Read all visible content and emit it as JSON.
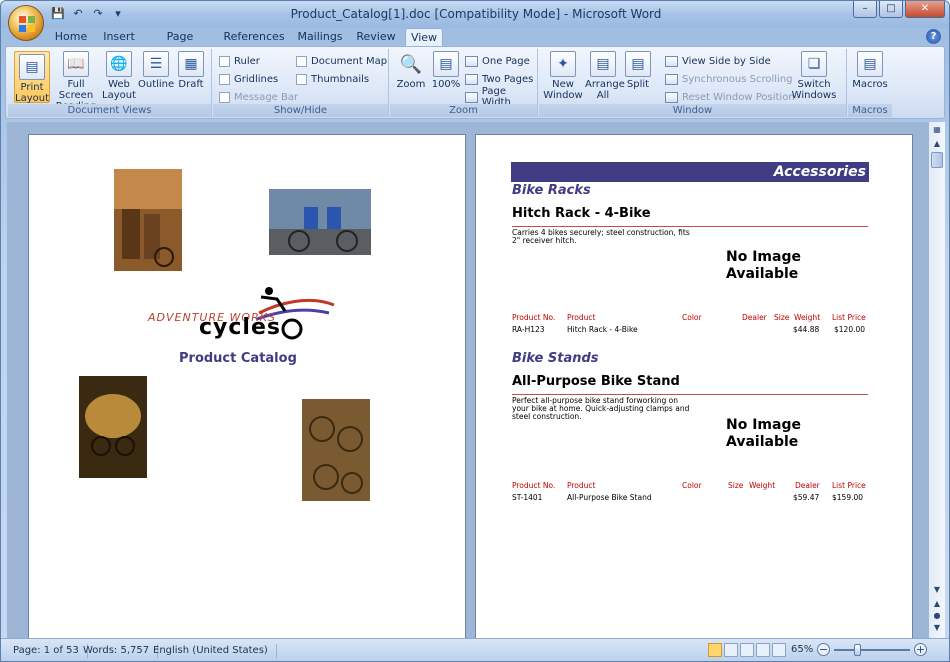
{
  "window": {
    "title": "Product_Catalog[1].doc [Compatibility Mode] - Microsoft Word",
    "help_glyph": "?"
  },
  "tabs": [
    {
      "label": "Home"
    },
    {
      "label": "Insert"
    },
    {
      "label": "Page Layout"
    },
    {
      "label": "References"
    },
    {
      "label": "Mailings"
    },
    {
      "label": "Review"
    },
    {
      "label": "View"
    }
  ],
  "ribbon": {
    "document_views": {
      "label": "Document Views",
      "print_layout": "Print Layout",
      "full_screen_reading": "Full Screen Reading",
      "web_layout": "Web Layout",
      "outline": "Outline",
      "draft": "Draft"
    },
    "show_hide": {
      "label": "Show/Hide",
      "ruler": "Ruler",
      "gridlines": "Gridlines",
      "message_bar": "Message Bar",
      "document_map": "Document Map",
      "thumbnails": "Thumbnails"
    },
    "zoom": {
      "label": "Zoom",
      "zoom": "Zoom",
      "hundred": "100%",
      "one_page": "One Page",
      "two_pages": "Two Pages",
      "page_width": "Page Width"
    },
    "window": {
      "label": "Window",
      "new_window": "New Window",
      "arrange_all": "Arrange All",
      "split": "Split",
      "view_side_by_side": "View Side by Side",
      "synchronous_scrolling": "Synchronous Scrolling",
      "reset_window_position": "Reset Window Position",
      "switch_windows": "Switch Windows"
    },
    "macros": {
      "label": "Macros",
      "macros": "Macros"
    }
  },
  "left_page": {
    "logo_text_top": "ADVENTURE WORKS",
    "logo_text_main": "cycles",
    "catalog_title": "Product Catalog"
  },
  "right_page": {
    "header": "Accessories",
    "sections": [
      {
        "category": "Bike Racks",
        "product": "Hitch Rack - 4-Bike",
        "description": "Carries 4 bikes securely; steel construction, fits 2\" receiver hitch.",
        "no_image": "No Image Available",
        "columns": [
          "Product No.",
          "Product",
          "Color",
          "Dealer",
          "Size",
          "Weight",
          "List Price"
        ],
        "row": {
          "product_no": "RA-H123",
          "product": "Hitch Rack - 4-Bike",
          "dealer": "$44.88",
          "list_price": "$120.00"
        }
      },
      {
        "category": "Bike Stands",
        "product": "All-Purpose Bike Stand",
        "description": "Perfect all-purpose bike stand forworking on your bike at home. Quick-adjusting clamps and steel construction.",
        "no_image": "No Image Available",
        "columns": [
          "Product No.",
          "Product",
          "Color",
          "Size",
          "Weight",
          "Dealer",
          "List Price"
        ],
        "row": {
          "product_no": "ST-1401",
          "product": "All-Purpose Bike Stand",
          "dealer": "$59.47",
          "list_price": "$159.00"
        }
      }
    ]
  },
  "status": {
    "page": "Page: 1 of 53",
    "words": "Words: 5,757",
    "language": "English (United States)",
    "zoom": "65%",
    "zoom_level": 0.65
  },
  "colors": {
    "accent": "#403c84",
    "table_header": "#c00000"
  }
}
